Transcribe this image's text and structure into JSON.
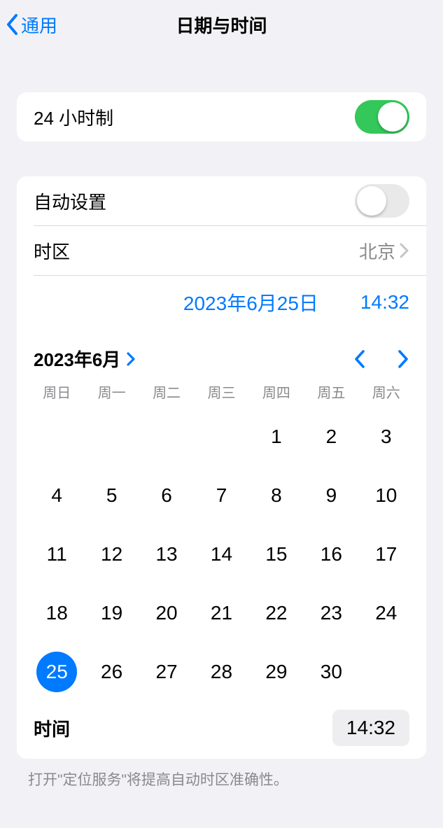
{
  "nav": {
    "back_label": "通用",
    "title": "日期与时间"
  },
  "settings": {
    "twentyfour_label": "24 小时制",
    "twentyfour_on": true,
    "auto_label": "自动设置",
    "auto_on": false,
    "timezone_label": "时区",
    "timezone_value": "北京"
  },
  "current": {
    "date_display": "2023年6月25日",
    "time_display": "14:32"
  },
  "calendar": {
    "month_header": "2023年6月",
    "weekdays": [
      "周日",
      "周一",
      "周二",
      "周三",
      "周四",
      "周五",
      "周六"
    ],
    "leading_blanks": 4,
    "days": [
      1,
      2,
      3,
      4,
      5,
      6,
      7,
      8,
      9,
      10,
      11,
      12,
      13,
      14,
      15,
      16,
      17,
      18,
      19,
      20,
      21,
      22,
      23,
      24,
      25,
      26,
      27,
      28,
      29,
      30
    ],
    "selected_day": 25,
    "time_label": "时间",
    "time_value": "14:32"
  },
  "footer": {
    "hint": "打开\"定位服务\"将提高自动时区准确性。"
  }
}
